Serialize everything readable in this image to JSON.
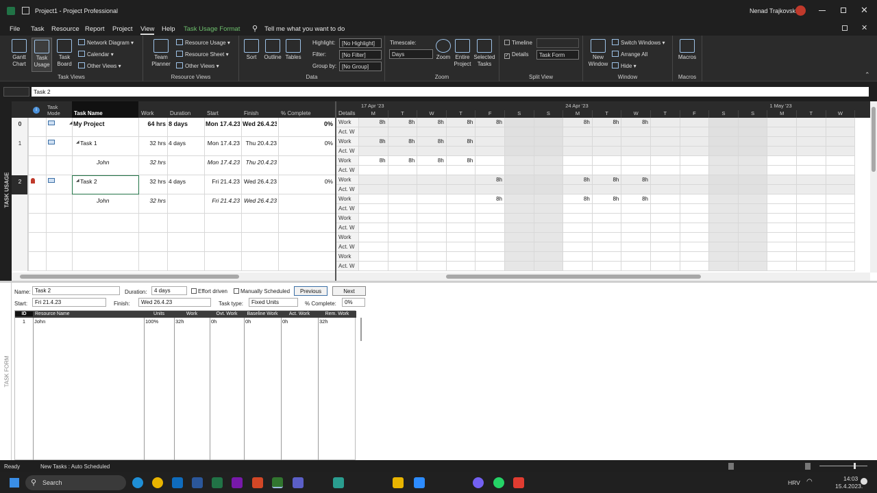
{
  "titlebar": {
    "title": "Project1 - Project Professional",
    "user": "Nenad Trajkovski"
  },
  "menu": [
    "File",
    "Task",
    "Resource",
    "Report",
    "Project",
    "View",
    "Help",
    "Task Usage Format"
  ],
  "menu_active": "View",
  "tell_me": "Tell me what you want to do",
  "ribbon": {
    "task_views": {
      "label": "Task Views",
      "gantt": "Gantt Chart",
      "task_usage": "Task Usage",
      "task_board": "Task Board",
      "network": "Network Diagram",
      "calendar": "Calendar",
      "other": "Other Views"
    },
    "resource_views": {
      "label": "Resource Views",
      "team_planner": "Team Planner",
      "usage": "Resource Usage",
      "sheet": "Resource Sheet",
      "other": "Other Views"
    },
    "data": {
      "label": "Data",
      "sort": "Sort",
      "outline": "Outline",
      "tables": "Tables",
      "highlight_label": "Highlight:",
      "highlight_value": "[No Highlight]",
      "filter_label": "Filter:",
      "filter_value": "[No Filter]",
      "group_label": "Group by:",
      "group_value": "[No Group]"
    },
    "zoom": {
      "label": "Zoom",
      "timescale": "Timescale:",
      "timescale_value": "Days",
      "zoom": "Zoom",
      "entire": "Entire Project",
      "selected": "Selected Tasks"
    },
    "split": {
      "label": "Split View",
      "timeline": "Timeline",
      "details": "Details",
      "details_value": "Task Form"
    },
    "window": {
      "label": "Window",
      "new_window": "New Window",
      "switch": "Switch Windows",
      "arrange": "Arrange All",
      "hide": "Hide"
    },
    "macros": {
      "label": "Macros",
      "macros": "Macros"
    }
  },
  "entry_value": "Task 2",
  "side_label_top": "TASK USAGE",
  "side_label_bottom": "TASK FORM",
  "table": {
    "headers": [
      "Task Mode",
      "Task Name",
      "Work",
      "Duration",
      "Start",
      "Finish",
      "% Complete"
    ],
    "details_header": "Details",
    "rows": [
      {
        "id": "0",
        "name": "My Project",
        "work": "64 hrs",
        "duration": "8 days",
        "start": "Mon 17.4.23",
        "finish": "Wed 26.4.23",
        "pct": "0%"
      },
      {
        "id": "1",
        "name": "Task 1",
        "work": "32 hrs",
        "duration": "4 days",
        "start": "Mon 17.4.23",
        "finish": "Thu 20.4.23",
        "pct": "0%"
      },
      {
        "id": "",
        "name": "John",
        "work": "32 hrs",
        "duration": "",
        "start": "Mon 17.4.23",
        "finish": "Thu 20.4.23",
        "pct": ""
      },
      {
        "id": "2",
        "name": "Task 2",
        "work": "32 hrs",
        "duration": "4 days",
        "start": "Fri 21.4.23",
        "finish": "Wed 26.4.23",
        "pct": "0%"
      },
      {
        "id": "",
        "name": "John",
        "work": "32 hrs",
        "duration": "",
        "start": "Fri 21.4.23",
        "finish": "Wed 26.4.23",
        "pct": ""
      }
    ]
  },
  "timescale": {
    "weeks": [
      "17 Apr '23",
      "24 Apr '23",
      "1 May '23"
    ],
    "days": [
      "M",
      "T",
      "W",
      "T",
      "F",
      "S",
      "S",
      "M",
      "T",
      "W",
      "T",
      "F",
      "S",
      "S",
      "M",
      "T",
      "W"
    ],
    "detail_labels": [
      "Work",
      "Act. W"
    ],
    "work_rows": [
      [
        "8h",
        "8h",
        "8h",
        "8h",
        "8h",
        "",
        "",
        "8h",
        "8h",
        "8h",
        "",
        "",
        "",
        "",
        "",
        "",
        ""
      ],
      [
        "",
        "",
        "",
        "",
        "",
        "",
        "",
        "",
        "",
        "",
        "",
        "",
        "",
        "",
        "",
        "",
        ""
      ],
      [
        "8h",
        "8h",
        "8h",
        "8h",
        "",
        "",
        "",
        "",
        "",
        "",
        "",
        "",
        "",
        "",
        "",
        "",
        ""
      ],
      [
        "",
        "",
        "",
        "",
        "",
        "",
        "",
        "",
        "",
        "",
        "",
        "",
        "",
        "",
        "",
        "",
        ""
      ],
      [
        "8h",
        "8h",
        "8h",
        "8h",
        "",
        "",
        "",
        "",
        "",
        "",
        "",
        "",
        "",
        "",
        "",
        "",
        ""
      ],
      [
        "",
        "",
        "",
        "",
        "",
        "",
        "",
        "",
        "",
        "",
        "",
        "",
        "",
        "",
        "",
        "",
        ""
      ],
      [
        "",
        "",
        "",
        "",
        "8h",
        "",
        "",
        "8h",
        "8h",
        "8h",
        "",
        "",
        "",
        "",
        "",
        "",
        ""
      ],
      [
        "",
        "",
        "",
        "",
        "",
        "",
        "",
        "",
        "",
        "",
        "",
        "",
        "",
        "",
        "",
        "",
        ""
      ],
      [
        "",
        "",
        "",
        "",
        "8h",
        "",
        "",
        "8h",
        "8h",
        "8h",
        "",
        "",
        "",
        "",
        "",
        "",
        ""
      ],
      [
        "",
        "",
        "",
        "",
        "",
        "",
        "",
        "",
        "",
        "",
        "",
        "",
        "",
        "",
        "",
        "",
        ""
      ],
      [
        "",
        "",
        "",
        "",
        "",
        "",
        "",
        "",
        "",
        "",
        "",
        "",
        "",
        "",
        "",
        "",
        ""
      ],
      [
        "",
        "",
        "",
        "",
        "",
        "",
        "",
        "",
        "",
        "",
        "",
        "",
        "",
        "",
        "",
        "",
        ""
      ],
      [
        "",
        "",
        "",
        "",
        "",
        "",
        "",
        "",
        "",
        "",
        "",
        "",
        "",
        "",
        "",
        "",
        ""
      ],
      [
        "",
        "",
        "",
        "",
        "",
        "",
        "",
        "",
        "",
        "",
        "",
        "",
        "",
        "",
        "",
        "",
        ""
      ],
      [
        "",
        "",
        "",
        "",
        "",
        "",
        "",
        "",
        "",
        "",
        "",
        "",
        "",
        "",
        "",
        "",
        ""
      ],
      [
        "",
        "",
        "",
        "",
        "",
        "",
        "",
        "",
        "",
        "",
        "",
        "",
        "",
        "",
        "",
        "",
        ""
      ]
    ]
  },
  "form": {
    "name_label": "Name:",
    "name": "Task 2",
    "duration_label": "Duration:",
    "duration": "4 days",
    "effort": "Effort driven",
    "manual": "Manually Scheduled",
    "previous": "Previous",
    "next": "Next",
    "start_label": "Start:",
    "start": "Fri 21.4.23",
    "finish_label": "Finish:",
    "finish": "Wed 26.4.23",
    "tasktype_label": "Task type:",
    "tasktype": "Fixed Units",
    "pct_label": "% Complete:",
    "pct": "0%",
    "res_headers": [
      "ID",
      "Resource Name",
      "Units",
      "Work",
      "Ovt. Work",
      "Baseline Work",
      "Act. Work",
      "Rem. Work"
    ],
    "res_row": [
      "1",
      "John",
      "100%",
      "32h",
      "0h",
      "0h",
      "0h",
      "32h"
    ]
  },
  "status": {
    "ready": "Ready",
    "new_tasks": "New Tasks : Auto Scheduled"
  },
  "taskbar": {
    "search": "Search",
    "lang": "HRV",
    "time": "14:03",
    "date": "15.4.2023."
  }
}
